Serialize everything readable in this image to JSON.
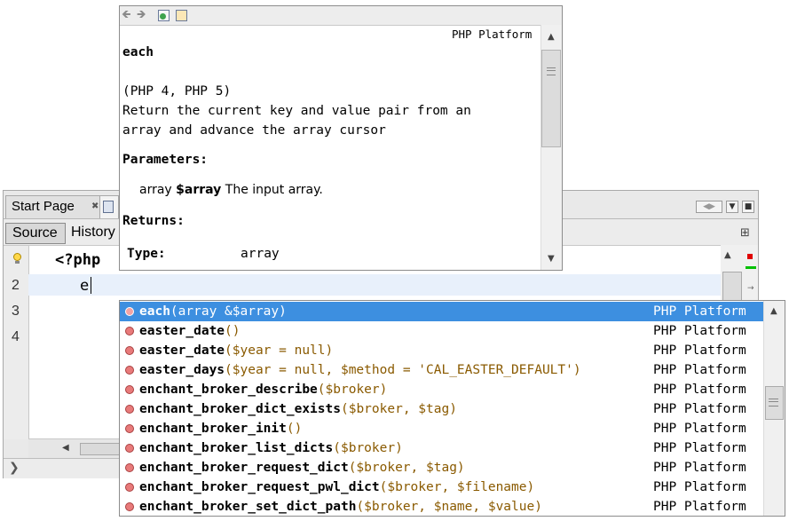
{
  "ide": {
    "tabs": {
      "start_page": "Start Page",
      "close_glyph": "x"
    },
    "toolbar": {
      "source": "Source",
      "history": "History"
    },
    "gutter": {
      "lines": [
        "2",
        "3",
        "4"
      ]
    },
    "code": {
      "line1": "<?php",
      "line2": "e"
    }
  },
  "doc_popup": {
    "platform": "PHP Platform",
    "function_name": "each",
    "version": "(PHP 4, PHP 5)",
    "description_line1": "Return the current key and value pair from an",
    "description_line2": "array and advance the array cursor",
    "parameters_label": "Parameters:",
    "param_type": "array",
    "param_name": "$array",
    "param_desc": "The input array.",
    "returns_label": "Returns:",
    "type_label": "Type:",
    "type_value": "array"
  },
  "completion": {
    "items": [
      {
        "name": "each",
        "params": "(array &$array)",
        "source": "PHP Platform"
      },
      {
        "name": "easter_date",
        "params": "()",
        "source": "PHP Platform"
      },
      {
        "name": "easter_date",
        "params": "($year = null)",
        "source": "PHP Platform"
      },
      {
        "name": "easter_days",
        "params": "($year = null, $method = 'CAL_EASTER_DEFAULT')",
        "source": "PHP Platform"
      },
      {
        "name": "enchant_broker_describe",
        "params": "($broker)",
        "source": "PHP Platform"
      },
      {
        "name": "enchant_broker_dict_exists",
        "params": "($broker, $tag)",
        "source": "PHP Platform"
      },
      {
        "name": "enchant_broker_init",
        "params": "()",
        "source": "PHP Platform"
      },
      {
        "name": "enchant_broker_list_dicts",
        "params": "($broker)",
        "source": "PHP Platform"
      },
      {
        "name": "enchant_broker_request_dict",
        "params": "($broker, $tag)",
        "source": "PHP Platform"
      },
      {
        "name": "enchant_broker_request_pwl_dict",
        "params": "($broker, $filename)",
        "source": "PHP Platform"
      },
      {
        "name": "enchant_broker_set_dict_path",
        "params": "($broker, $name, $value)",
        "source": "PHP Platform"
      }
    ]
  },
  "colors": {
    "selection": "#3d8fe0",
    "param_text": "#8a5a00",
    "current_line": "#e8f0fb",
    "error_marker": "#e00000",
    "ok_marker": "#00c000"
  },
  "icons": {
    "doc_toolbar": [
      "back-arrow-icon",
      "forward-arrow-icon",
      "open-in-browser-icon",
      "go-to-source-icon"
    ],
    "gutter": "lightbulb-icon",
    "completion_item": "method-dot-icon"
  }
}
